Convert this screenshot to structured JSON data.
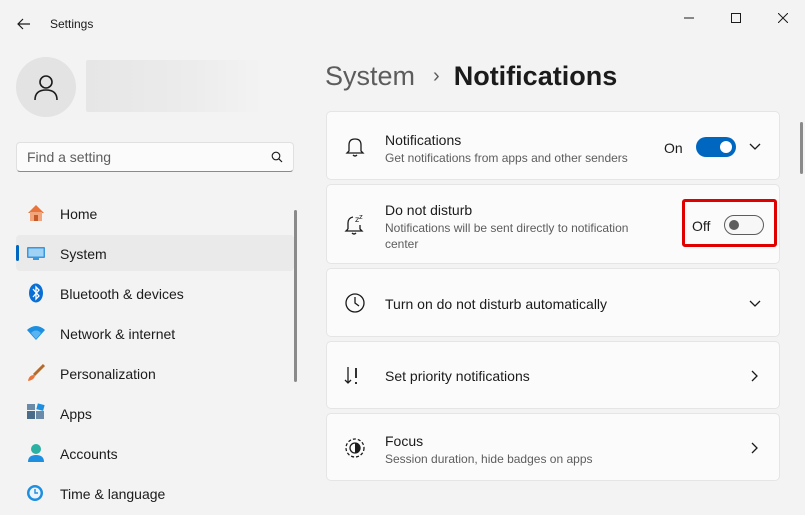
{
  "window": {
    "title": "Settings",
    "back_icon": "arrow-left-icon",
    "controls": [
      "minimize-icon",
      "maximize-icon",
      "close-icon"
    ]
  },
  "profile": {
    "avatar_icon": "person-icon"
  },
  "search": {
    "placeholder": "Find a setting",
    "value": "",
    "icon": "search-icon"
  },
  "sidebar": {
    "items": [
      {
        "label": "Home",
        "icon": "home-icon",
        "selected": false
      },
      {
        "label": "System",
        "icon": "system-display-icon",
        "selected": true
      },
      {
        "label": "Bluetooth & devices",
        "icon": "bluetooth-icon",
        "selected": false
      },
      {
        "label": "Network & internet",
        "icon": "wifi-icon",
        "selected": false
      },
      {
        "label": "Personalization",
        "icon": "paintbrush-icon",
        "selected": false
      },
      {
        "label": "Apps",
        "icon": "apps-icon",
        "selected": false
      },
      {
        "label": "Accounts",
        "icon": "accounts-icon",
        "selected": false
      },
      {
        "label": "Time & language",
        "icon": "clock-globe-icon",
        "selected": false
      }
    ]
  },
  "breadcrumb": {
    "parent": "System",
    "separator": "›",
    "current": "Notifications"
  },
  "cards": {
    "notifications": {
      "title": "Notifications",
      "subtitle": "Get notifications from apps and other senders",
      "toggle_label": "On",
      "toggle_state": "on",
      "icon": "bell-icon"
    },
    "dnd": {
      "title": "Do not disturb",
      "subtitle": "Notifications will be sent directly to notification center",
      "toggle_label": "Off",
      "toggle_state": "off",
      "icon": "bell-snooze-icon"
    },
    "auto_dnd": {
      "title": "Turn on do not disturb automatically",
      "icon": "clock-icon"
    },
    "priority": {
      "title": "Set priority notifications",
      "icon": "sort-priority-icon"
    },
    "focus": {
      "title": "Focus",
      "subtitle": "Session duration, hide badges on apps",
      "icon": "focus-icon"
    }
  },
  "colors": {
    "accent": "#0067c0",
    "highlight": "#e00000",
    "background": "#f3f3f3"
  }
}
